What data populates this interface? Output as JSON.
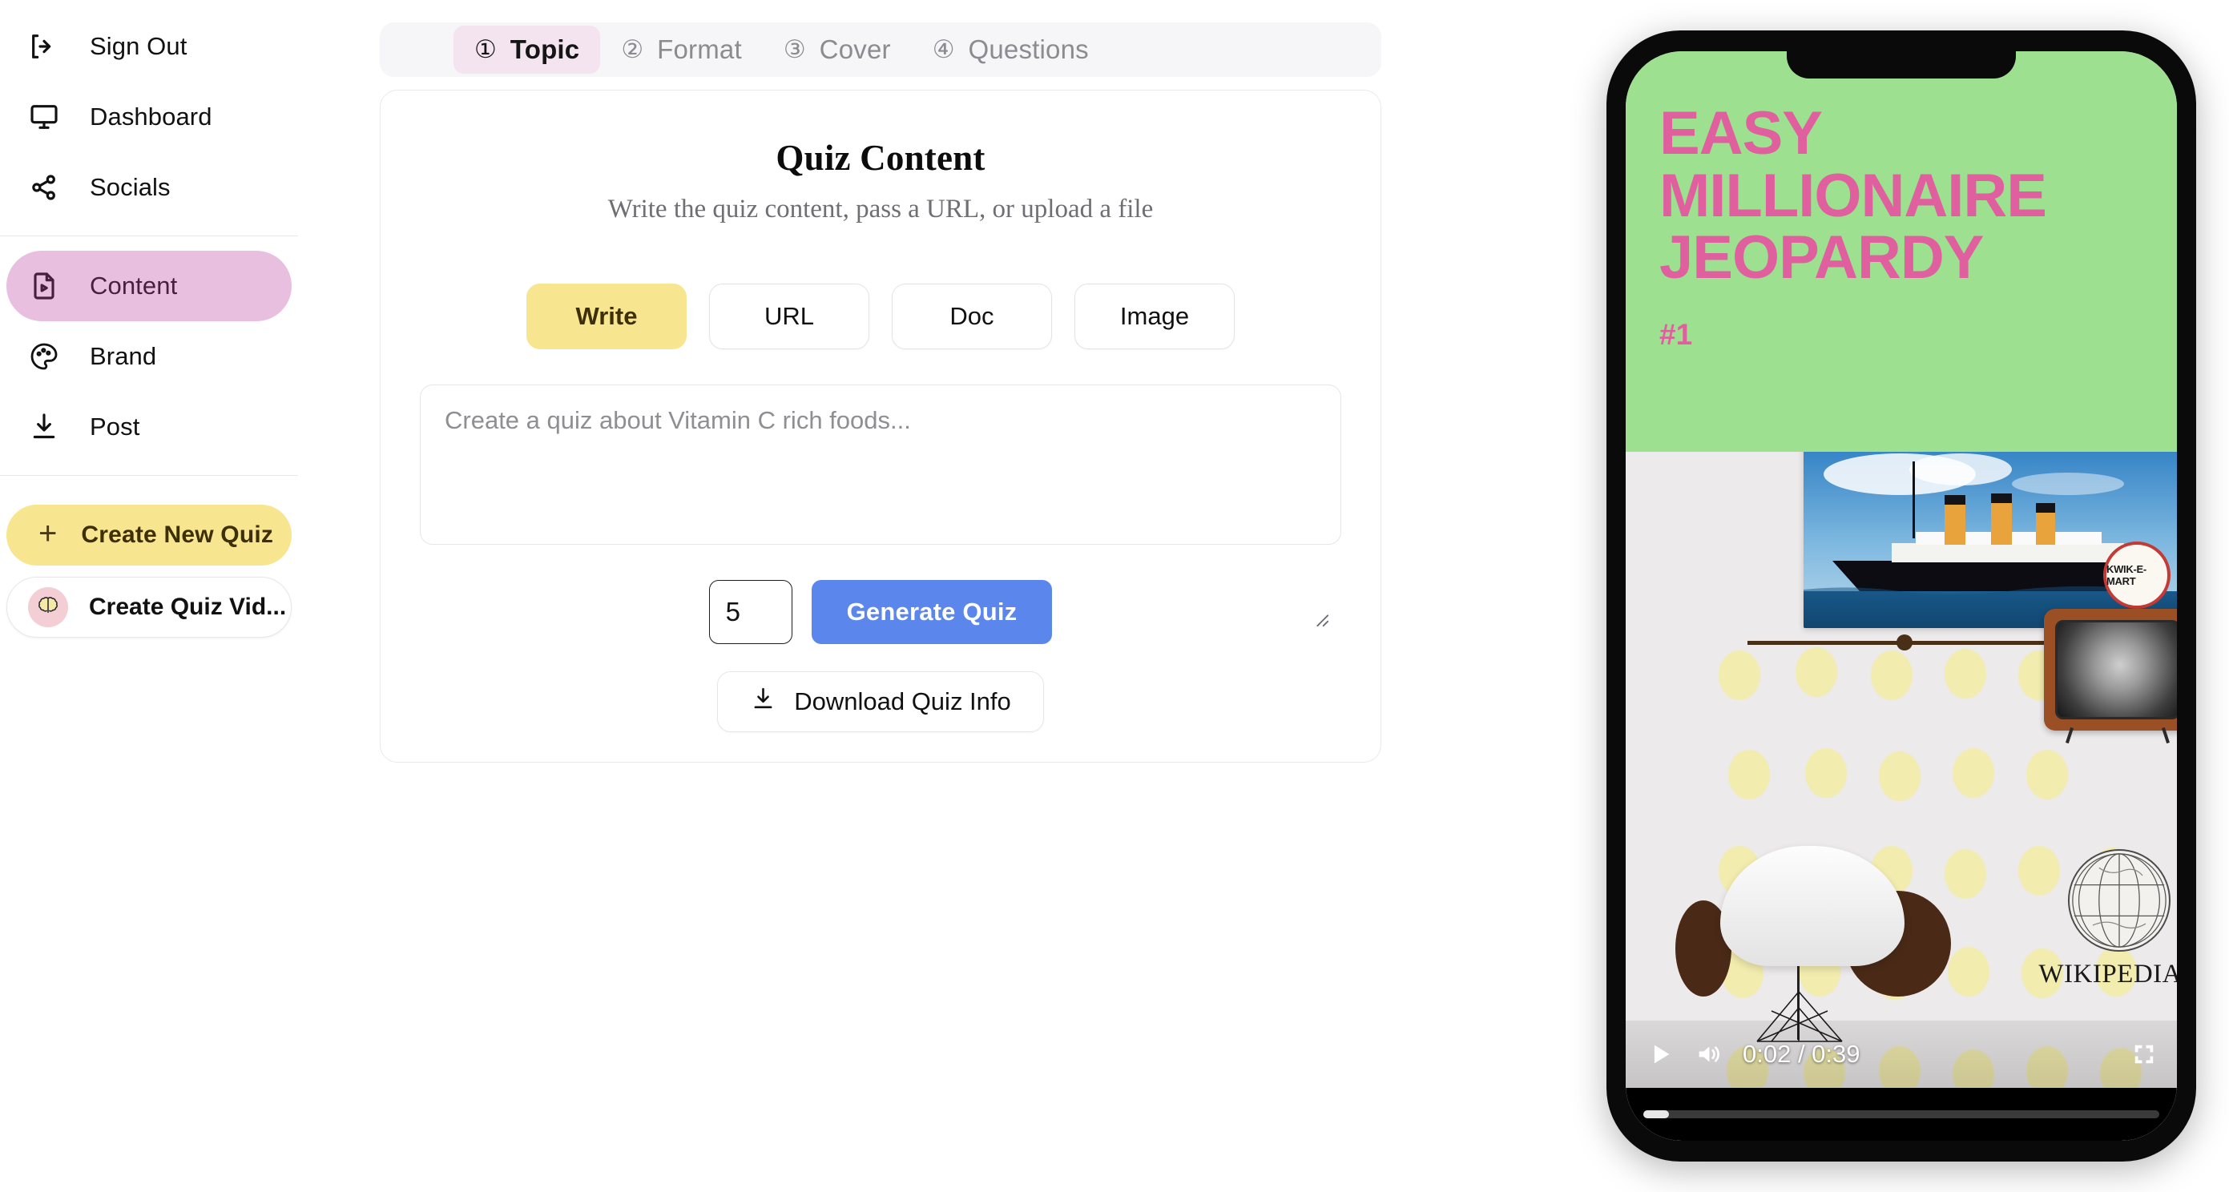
{
  "sidebar": {
    "items": [
      {
        "label": "Sign Out",
        "icon": "sign-out-icon",
        "active": false
      },
      {
        "label": "Dashboard",
        "icon": "monitor-icon",
        "active": false
      },
      {
        "label": "Socials",
        "icon": "share-icon",
        "active": false
      },
      {
        "label": "Content",
        "icon": "file-video-icon",
        "active": true
      },
      {
        "label": "Brand",
        "icon": "palette-icon",
        "active": false
      },
      {
        "label": "Post",
        "icon": "download-icon",
        "active": false
      }
    ],
    "create_new_quiz": "Create New Quiz",
    "create_new_quiz_plus": "+",
    "create_quiz_video": "Create Quiz Vid..."
  },
  "steps": [
    {
      "num": "①",
      "label": "Topic",
      "active": true
    },
    {
      "num": "②",
      "label": "Format",
      "active": false
    },
    {
      "num": "③",
      "label": "Cover",
      "active": false
    },
    {
      "num": "④",
      "label": "Questions",
      "active": false
    }
  ],
  "card": {
    "title": "Quiz Content",
    "subtitle": "Write the quiz content, pass a URL, or upload a file",
    "modes": [
      {
        "label": "Write",
        "selected": true
      },
      {
        "label": "URL",
        "selected": false
      },
      {
        "label": "Doc",
        "selected": false
      },
      {
        "label": "Image",
        "selected": false
      }
    ],
    "textarea_placeholder": "Create a quiz about Vitamin C rich foods...",
    "textarea_value": "",
    "question_count": "5",
    "generate_label": "Generate Quiz",
    "download_label": "Download Quiz Info"
  },
  "phone": {
    "video": {
      "title": "EASY MILLIONAIRE JEOPARDY",
      "number": "#1",
      "header_bg": "#9de08f",
      "title_color": "#e0609f",
      "badge_text": "KWIK-E-MART",
      "wikipedia_text": "WIKIPEDIA",
      "current_time": "0:02",
      "duration": "0:39",
      "time_display": "0:02 / 0:39",
      "progress_percent": 5,
      "play_icon": "play-icon",
      "volume_icon": "volume-icon",
      "fullscreen_icon": "fullscreen-icon"
    }
  }
}
